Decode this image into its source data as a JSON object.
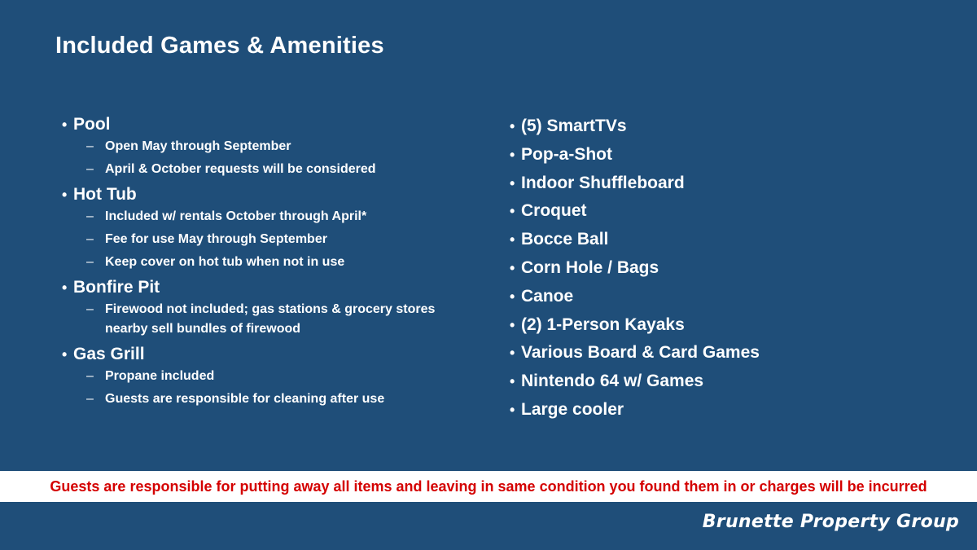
{
  "title": "Included Games & Amenities",
  "left_items": [
    {
      "label": "Pool",
      "subs": [
        "Open May through September",
        "April & October requests will be considered"
      ]
    },
    {
      "label": "Hot Tub",
      "subs": [
        "Included w/ rentals October through April*",
        "Fee for use May through September",
        "Keep cover on hot tub when not in use"
      ]
    },
    {
      "label": "Bonfire Pit",
      "subs": [
        "Firewood not included; gas stations & grocery stores nearby sell bundles of firewood"
      ]
    },
    {
      "label": "Gas Grill",
      "subs": [
        "Propane included",
        "Guests are responsible for cleaning after use"
      ]
    }
  ],
  "right_items": [
    "(5) SmartTVs",
    "Pop-a-Shot",
    "Indoor Shuffleboard",
    "Croquet",
    "Bocce Ball",
    "Corn Hole / Bags",
    "Canoe",
    "(2) 1-Person Kayaks",
    "Various Board & Card Games",
    "Nintendo 64 w/ Games",
    "Large cooler"
  ],
  "notice": "Guests are responsible for putting away all items and leaving in same condition you found them in or charges will be incurred",
  "brand": "Brunette Property Group",
  "colors": {
    "background": "#1f4e79",
    "notice_text": "#d40000",
    "notice_band": "#ffffff"
  }
}
